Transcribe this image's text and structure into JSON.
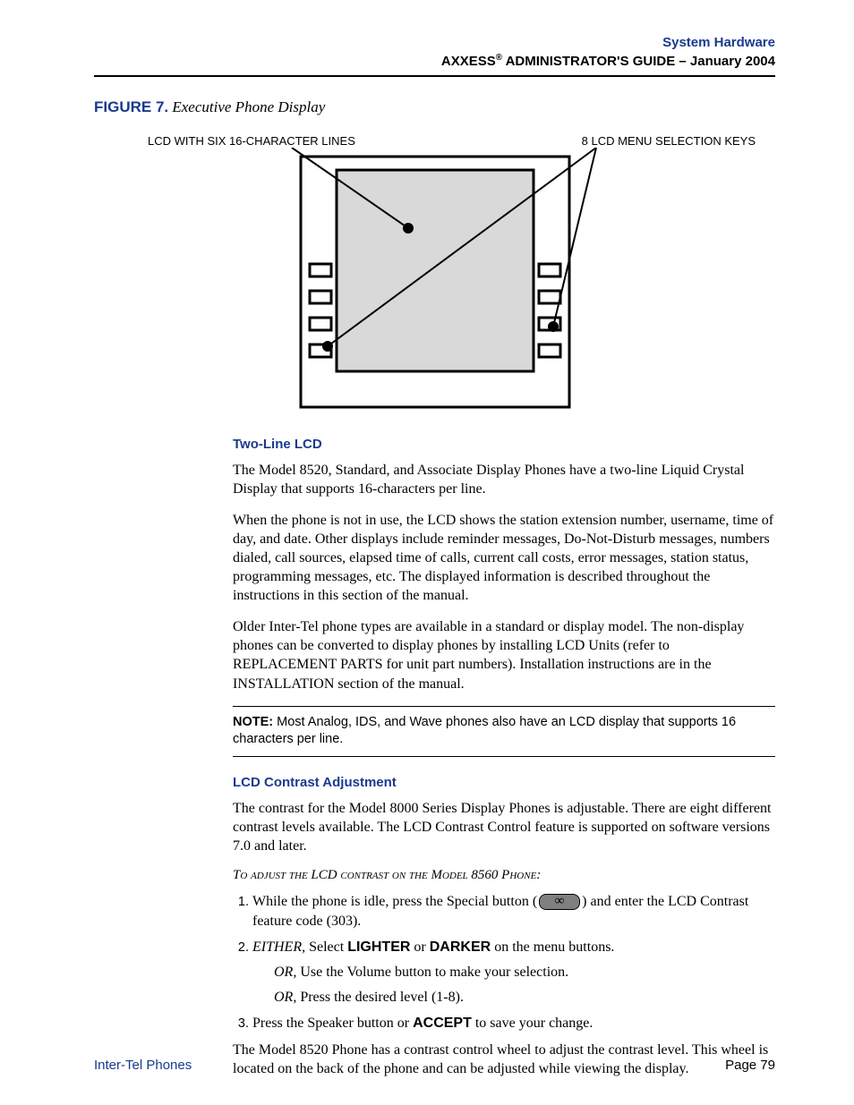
{
  "header": {
    "line1": "System Hardware",
    "product": "AXXESS",
    "reg": "®",
    "guide": " ADMINISTRATOR'S GUIDE – January 2004"
  },
  "figure": {
    "label": "FIGURE 7.",
    "title": "  Executive Phone Display",
    "callout_left": "LCD WITH SIX 16-CHARACTER LINES",
    "callout_right": "8 LCD MENU SELECTION KEYS"
  },
  "sections": {
    "twoline": {
      "heading": "Two-Line LCD",
      "p1": "The Model 8520, Standard, and Associate Display Phones have a two-line Liquid Crystal Display that supports 16-characters per line.",
      "p2": "When the phone is not in use, the LCD shows the station extension number, username, time of day, and date. Other displays include reminder messages, Do-Not-Disturb messages, numbers dialed, call sources, elapsed time of calls, current call costs, error messages, station status, programming messages, etc. The displayed information is described throughout the instructions in this section of the manual.",
      "p3": "Older Inter-Tel phone types are available in a standard or display model. The non-display phones can be converted to display phones by installing LCD Units (refer to REPLACEMENT PARTS for unit part numbers). Installation instructions are in the INSTALLATION section of the manual.",
      "note_label": "NOTE:",
      "note_body": " Most Analog, IDS, and Wave phones also have an LCD display that supports 16 characters per line."
    },
    "contrast": {
      "heading": "LCD Contrast Adjustment",
      "p1": "The contrast for the Model 8000 Series Display Phones is adjustable. There are eight different contrast levels available. The LCD Contrast Control feature is supported on software versions 7.0 and later.",
      "proc_title": "To adjust the LCD contrast on the Model 8560 Phone:",
      "step1_a": "While the phone is idle, press the Special button (",
      "step1_b": ") and enter the LCD Contrast feature code (303).",
      "step2_either": "EITHER,",
      "step2_select": " Select ",
      "step2_lighter": "LIGHTER",
      "step2_or_word": " or ",
      "step2_darker": "DARKER",
      "step2_tail": " on the menu buttons.",
      "or_label": "OR,",
      "step2_sub1": " Use the Volume button to make your selection.",
      "step2_sub2": " Press the desired level (1-8).",
      "step3_a": "Press the Speaker button or ",
      "step3_accept": "ACCEPT",
      "step3_b": " to save your change.",
      "p_after": "The Model 8520 Phone has a contrast control wheel to adjust the contrast level. This wheel is located on the back of the phone and can be adjusted while viewing the display."
    }
  },
  "footer": {
    "left": "Inter-Tel Phones",
    "right": "Page 79"
  }
}
